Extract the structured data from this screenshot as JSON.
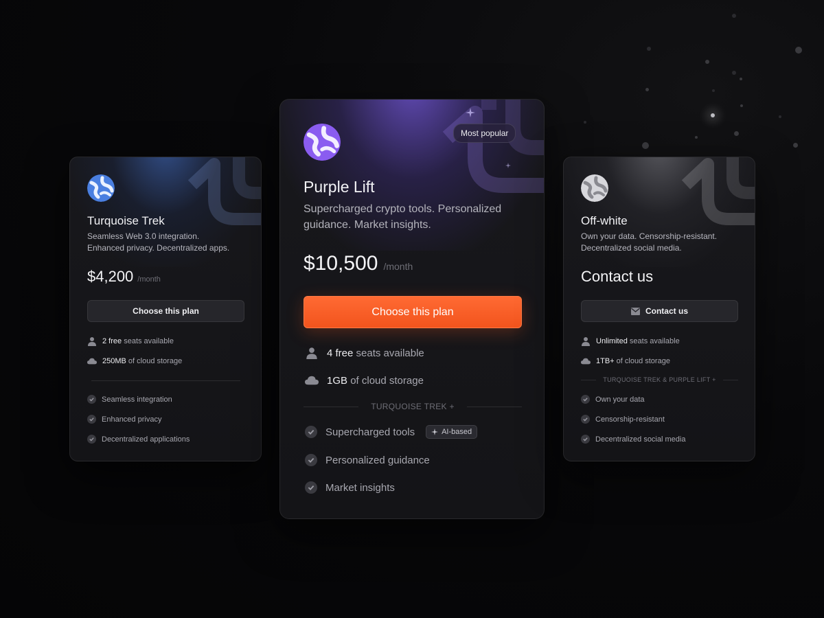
{
  "plans": {
    "left": {
      "name": "Turquoise Trek",
      "desc_line1": "Seamless Web 3.0 integration.",
      "desc_line2": "Enhanced privacy. Decentralized apps.",
      "price": "$4,200",
      "period": "/month",
      "button": "Choose this plan",
      "seats_value": "2 free",
      "seats_text": "seats available",
      "storage_value": "250MB",
      "storage_text": "of cloud storage",
      "features": [
        "Seamless integration",
        "Enhanced privacy",
        "Decentralized applications"
      ],
      "accent": "#4a7fe0"
    },
    "mid": {
      "badge": "Most popular",
      "name": "Purple Lift",
      "desc_line1": "Supercharged crypto tools. Personalized",
      "desc_line2": "guidance. Market insights.",
      "price": "$10,500",
      "period": "/month",
      "button": "Choose this plan",
      "seats_value": "4 free",
      "seats_text": "seats available",
      "storage_value": "1GB",
      "storage_text": "of cloud storage",
      "includes": "TURQUOISE TREK +",
      "features": [
        "Supercharged tools",
        "Personalized guidance",
        "Market insights"
      ],
      "feature_tag": "AI-based",
      "accent": "#8a5cf0",
      "button_color": "#f45a22"
    },
    "right": {
      "name": "Off-white",
      "desc_line1": "Own your data. Censorship-resistant.",
      "desc_line2": "Decentralized social media.",
      "price": "Contact us",
      "button": "Contact us",
      "seats_value": "Unlimited",
      "seats_text": "seats available",
      "storage_value": "1TB+",
      "storage_text": "of cloud storage",
      "includes": "TURQUOISE TREK & PURPLE LIFT +",
      "features": [
        "Own your data",
        "Censorship-resistant",
        "Decentralized social media"
      ],
      "accent": "#d8d8dc"
    }
  },
  "icons": {
    "user": "user-icon",
    "cloud": "cloud-icon",
    "check": "check-icon",
    "mail": "mail-icon",
    "sparkle": "sparkle-icon"
  }
}
